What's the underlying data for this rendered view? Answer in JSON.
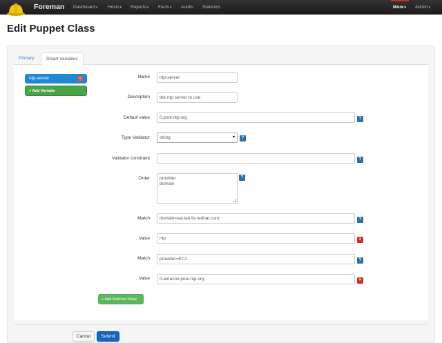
{
  "navbar": {
    "brand": "Foreman",
    "menu": [
      {
        "label": "Dashboard",
        "caret": "▾"
      },
      {
        "label": "Hosts",
        "caret": "▾"
      },
      {
        "label": "Reports",
        "caret": "▾"
      },
      {
        "label": "Facts",
        "caret": "▾"
      },
      {
        "label": "Audits",
        "caret": ""
      },
      {
        "label": "Statistics",
        "caret": ""
      }
    ],
    "right": [
      {
        "label": "More",
        "caret": "▾"
      },
      {
        "label": "Admin",
        "caret": "▾"
      }
    ],
    "logo_icon": "hard-hat-icon",
    "colors": {
      "bar": "#222222",
      "logo": "#f0c419"
    }
  },
  "page_title": "Edit Puppet Class",
  "tabs": [
    "Primary",
    "Smart Variables"
  ],
  "active_tab": "Smart Variables",
  "sidebar": {
    "variables": [
      {
        "name": "ntp-server",
        "remove_glyph": "×"
      }
    ],
    "add_variable_label": "+ Add Variable"
  },
  "form": {
    "name": {
      "label": "Name",
      "value": "ntp-server"
    },
    "description": {
      "label": "Description",
      "value": "the ntp server to use"
    },
    "default_value": {
      "label": "Default value",
      "value": "0.pool.ntp.org"
    },
    "type_validator": {
      "label": "Type Validator",
      "value": "string"
    },
    "validator_constraint": {
      "label": "Validator constraint",
      "value": ""
    },
    "order": {
      "label": "Order",
      "lines": [
        "provider",
        "domain"
      ]
    },
    "matchers": [
      {
        "match_label": "Match",
        "match": "domain=sat.lab.tlv.redhat.com",
        "value_label": "Value",
        "value": "ntp"
      },
      {
        "match_label": "Match",
        "match": "provider=EC2",
        "value_label": "Value",
        "value": "0.amazon.pool.ntp.org"
      }
    ],
    "help_glyph": "?",
    "remove_glyph": "×",
    "add_matcher_label": "+ Add Matcher-Value"
  },
  "actions": {
    "cancel": "Cancel",
    "submit": "Submit"
  },
  "colors": {
    "primary": "#1565c0",
    "success": "#5cb85c",
    "danger": "#c9302c",
    "help": "#2f6f9f",
    "link": "#2a7dc8"
  }
}
